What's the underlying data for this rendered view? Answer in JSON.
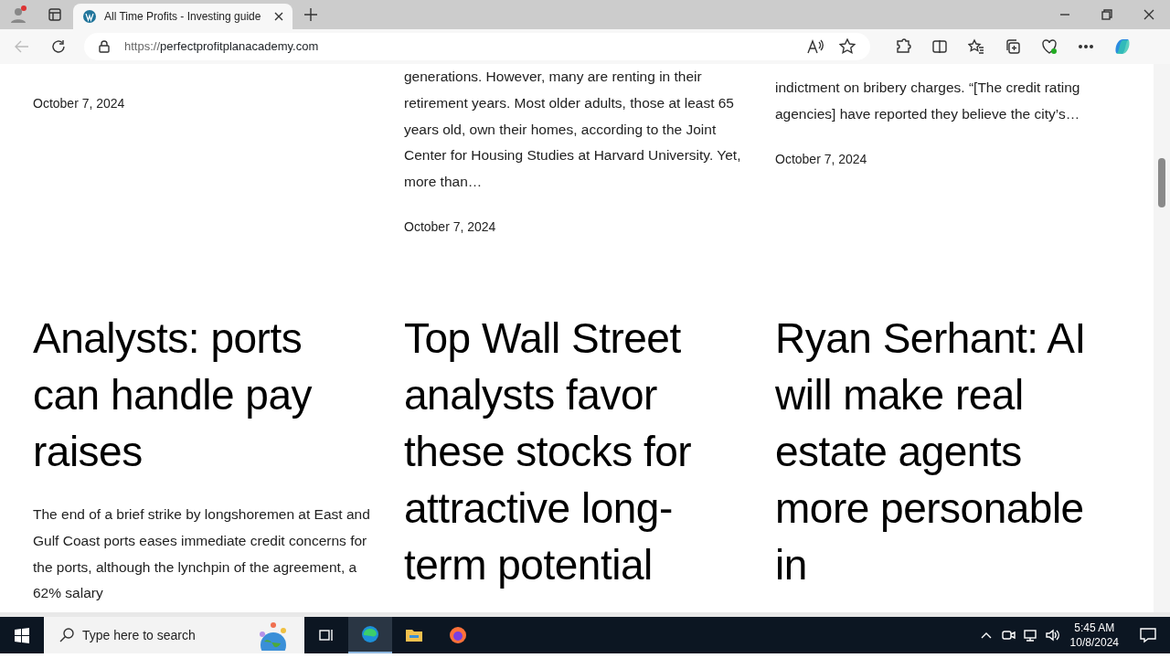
{
  "browser": {
    "tab": {
      "title": "All Time Profits - Investing guide",
      "selected": true
    },
    "url_scheme": "https://",
    "url_host": "perfectprofitplanacademy.com"
  },
  "top_posts": [
    {
      "date": "October 7, 2024"
    },
    {
      "excerpt": "generations. However, many are renting in their retirement years.  Most older adults, those at least 65 years old, own their homes, according to the Joint Center for Housing Studies at Harvard University. Yet, more than…",
      "date": "October 7, 2024"
    },
    {
      "excerpt": "indictment on bribery charges.  “[The credit rating agencies] have reported they believe the city’s…",
      "date": "October 7, 2024"
    }
  ],
  "posts": [
    {
      "title": "Analysts: ports can handle pay raises",
      "excerpt": "The end of a brief strike by longshoremen at East and Gulf Coast ports eases immediate credit concerns for the ports, although the lynchpin of the agreement, a 62% salary"
    },
    {
      "title": "Top Wall Street analysts favor these stocks for attractive long-term potential"
    },
    {
      "title": "Ryan Serhant: AI will make real estate agents more personable in"
    }
  ],
  "taskbar": {
    "search_placeholder": "Type here to search",
    "apps": [
      {
        "kind": "edge",
        "selected": true
      },
      {
        "kind": "files",
        "selected": false
      },
      {
        "kind": "firefox",
        "selected": false
      }
    ],
    "time": "5:45 AM",
    "date": "10/8/2024"
  }
}
